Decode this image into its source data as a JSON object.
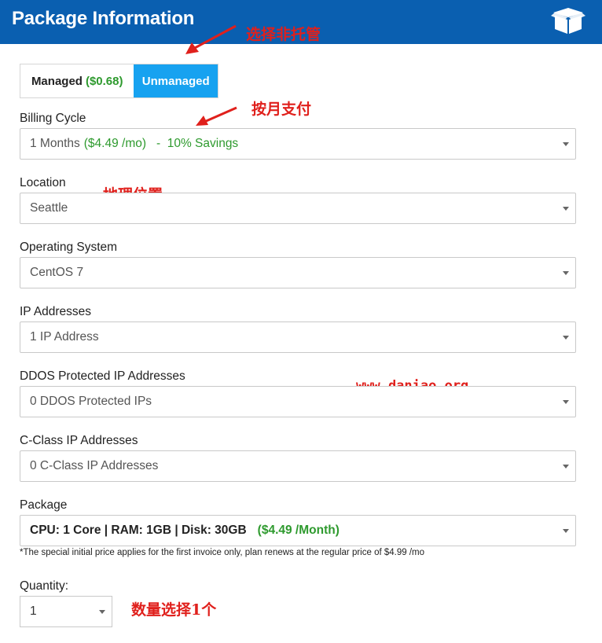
{
  "header": {
    "title": "Package Information",
    "icon": "box-icon",
    "bg_color": "#0a5fb0"
  },
  "management": {
    "managed_label": "Managed",
    "managed_price": "($0.68)",
    "unmanaged_label": "Unmanaged",
    "selected": "Unmanaged"
  },
  "fields": {
    "billing_cycle": {
      "label": "Billing Cycle",
      "value_prefix": "1 Months",
      "value_price": "($4.49 /mo)   -  10% Savings"
    },
    "location": {
      "label": "Location",
      "value": "Seattle"
    },
    "os": {
      "label": "Operating System",
      "value": "CentOS 7"
    },
    "ip": {
      "label": "IP Addresses",
      "value": "1 IP Address"
    },
    "ddos": {
      "label": "DDOS Protected IP Addresses",
      "value": "0 DDOS Protected IPs"
    },
    "cclass": {
      "label": "C-Class IP Addresses",
      "value": "0 C-Class IP Addresses"
    },
    "package": {
      "label": "Package",
      "value": "CPU: 1 Core | RAM: 1GB | Disk: 30GB",
      "price": "($4.49 /Month)"
    }
  },
  "note": "*The special initial price applies for the first invoice only, plan renews at the regular price of $4.99 /mo",
  "quantity": {
    "label": "Quantity:",
    "value": "1"
  },
  "annotations": {
    "unmanaged": "选择非托管",
    "monthly": "按月支付",
    "location": "地理位置",
    "quantity": "数量选择1个",
    "watermark": "www.daniao.org"
  },
  "colors": {
    "accent": "#17a2f0",
    "price_green": "#2e9a2e",
    "annotation_red": "#e0201c"
  }
}
